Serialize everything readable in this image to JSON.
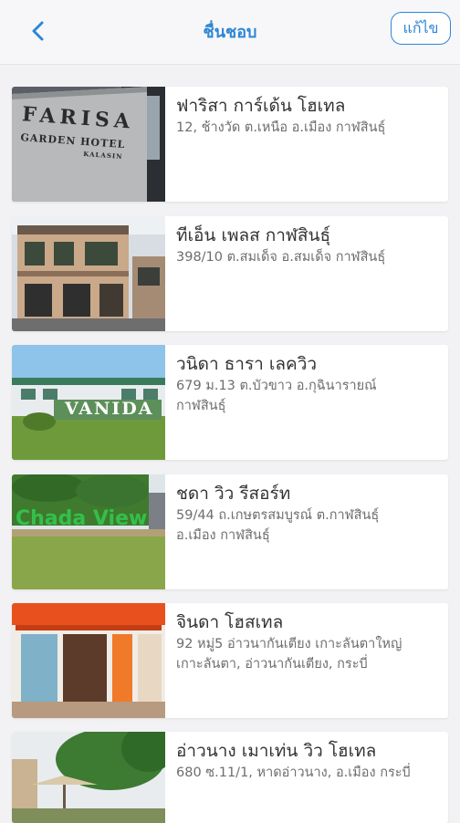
{
  "header": {
    "title": "ชื่นชอบ",
    "edit_label": "แก้ไข",
    "back_icon": "chevron-left-icon",
    "accent_color": "#2e86d6"
  },
  "hotels": [
    {
      "name": "ฟาริสา การ์เด้น โฮเทล",
      "address": "12, ช้างวัด ต.เหนือ อ.เมือง กาฬสินธุ์",
      "photo_sign": "FARISA GARDEN HOTEL KALASIN"
    },
    {
      "name": "ทีเอ็น เพลส กาฬสินธุ์",
      "address": "398/10 ต.สมเด็จ อ.สมเด็จ กาฬสินธุ์"
    },
    {
      "name": "วนิดา ธารา เลควิว",
      "address": "679 ม.13 ต.บัวขาว อ.กุฉินารายณ์ กาฬสินธุ์",
      "photo_sign": "VANIDA"
    },
    {
      "name": "ชดา วิว รีสอร์ท",
      "address": "59/44 ถ.เกษตรสมบูรณ์ ต.กาฬสินธุ์ อ.เมือง กาฬสินธุ์",
      "photo_sign": "Chada View"
    },
    {
      "name": "จินดา โฮสเทล",
      "address": "92 หมู่5 อ่าวนากันเตียง เกาะลันตาใหญ่ เกาะลันตา, อ่าวนากันเตียง, กระบี่"
    },
    {
      "name": "อ่าวนาง เมาเท่น วิว โฮเทล",
      "address": "680 ซ.11/1, หาดอ่าวนาง, อ.เมือง กระบี่"
    }
  ]
}
